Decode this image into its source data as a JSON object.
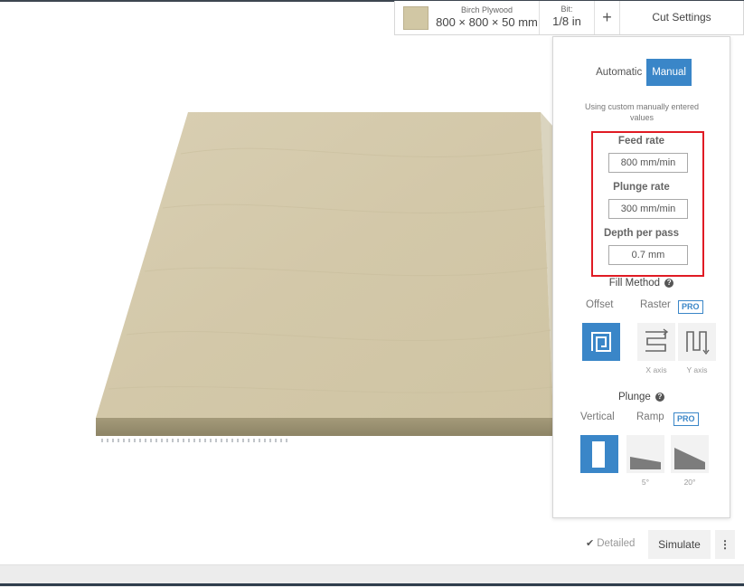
{
  "toolbar": {
    "material_name": "Birch Plywood",
    "material_size": "800 × 800 × 50 mm",
    "material_color": "#d1c7a4",
    "bit_label": "Bit:",
    "bit_value": "1/8 in",
    "add_symbol": "+",
    "cut_settings_label": "Cut Settings"
  },
  "panel": {
    "mode_options": [
      "Automatic",
      "Manual"
    ],
    "active_mode": "Manual",
    "description": "Using custom manually entered values",
    "fields": [
      {
        "label": "Feed rate",
        "value": "800 mm/min"
      },
      {
        "label": "Plunge rate",
        "value": "300 mm/min"
      },
      {
        "label": "Depth per pass",
        "value": "0.7 mm"
      }
    ],
    "fill_method": {
      "title": "Fill Method",
      "offset_label": "Offset",
      "raster_label": "Raster",
      "pro_badge": "PRO",
      "x_axis_label": "X axis",
      "y_axis_label": "Y axis"
    },
    "plunge": {
      "title": "Plunge",
      "vertical_label": "Vertical",
      "ramp_label": "Ramp",
      "pro_badge": "PRO",
      "ramp_5_label": "5°",
      "ramp_20_label": "20°"
    },
    "accent_color": "#3a86c8",
    "highlight_color": "#e01b24"
  },
  "actions": {
    "detailed_label": "Detailed",
    "simulate_label": "Simulate",
    "more_symbol": "⋮"
  }
}
